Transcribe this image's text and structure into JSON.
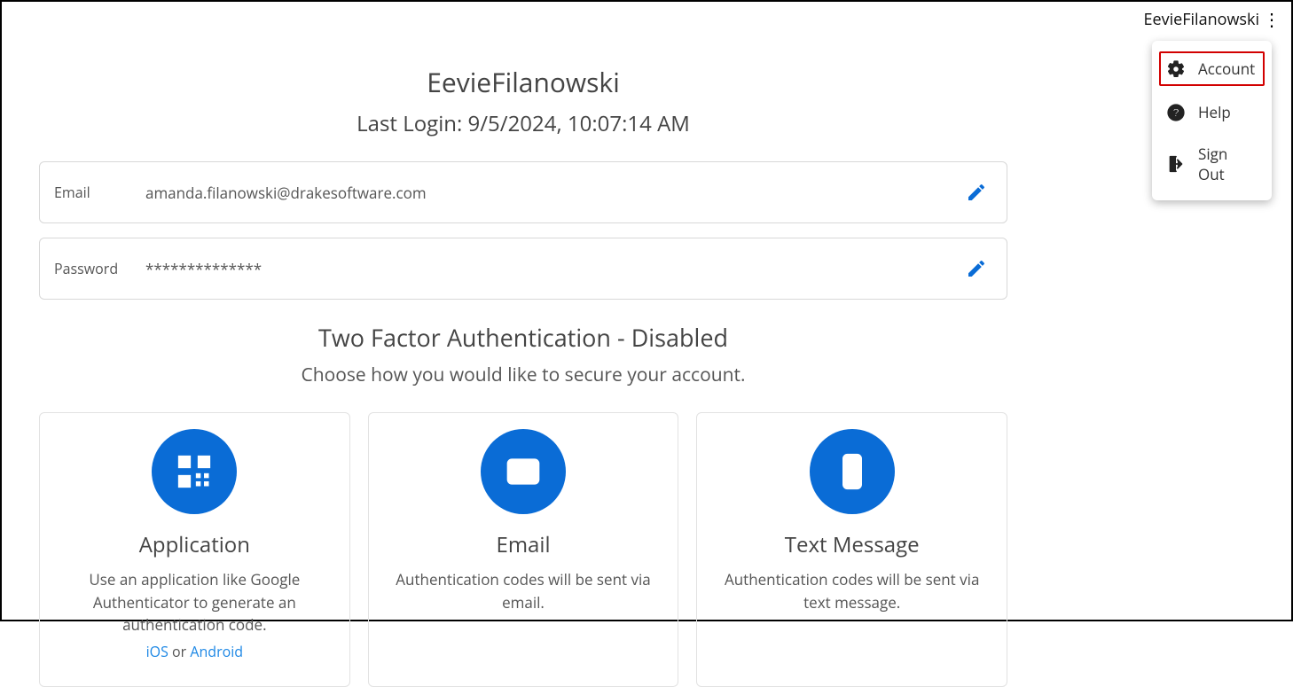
{
  "header": {
    "username": "EevieFilanowski",
    "menu": {
      "account": "Account",
      "help": "Help",
      "signout": "Sign Out"
    }
  },
  "profile": {
    "title": "EevieFilanowski",
    "lastLogin": "Last Login: 9/5/2024, 10:07:14 AM",
    "emailLabel": "Email",
    "emailValue": "amanda.filanowski@drakesoftware.com",
    "passwordLabel": "Password",
    "passwordValue": "**************"
  },
  "tfa": {
    "title": "Two Factor Authentication - Disabled",
    "subtitle": "Choose how you would like to secure your account.",
    "cards": {
      "app": {
        "title": "Application",
        "desc": "Use an application like Google Authenticator to generate an authentication code.",
        "ios": "iOS",
        "or": " or ",
        "android": "Android"
      },
      "email": {
        "title": "Email",
        "desc": "Authentication codes will be sent via email."
      },
      "text": {
        "title": "Text Message",
        "desc": "Authentication codes will be sent via text message."
      }
    }
  }
}
